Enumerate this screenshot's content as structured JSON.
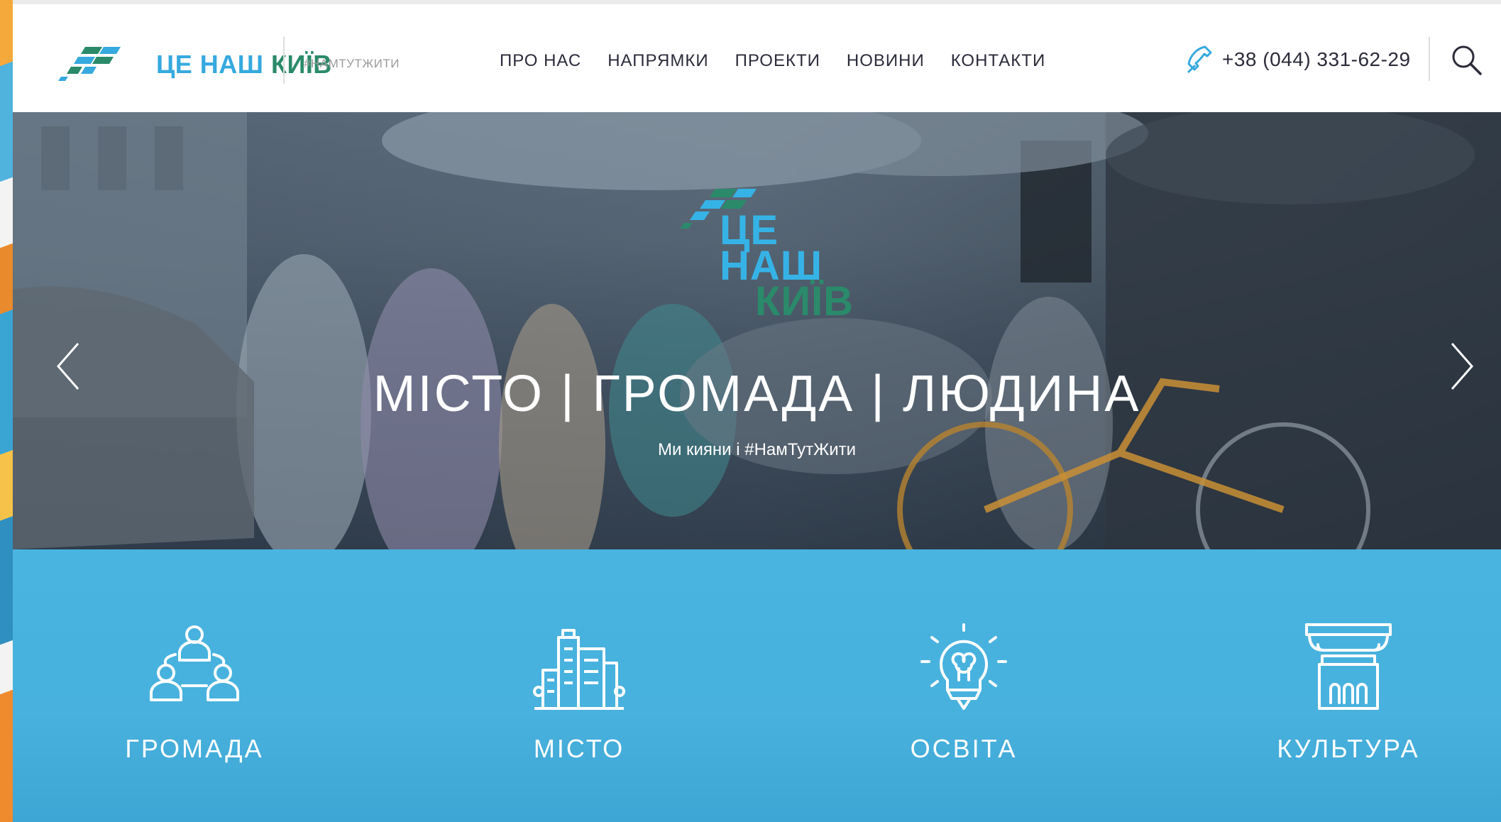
{
  "header": {
    "logo": {
      "part1": "ЦЕ НАШ",
      "part2": "КИЇВ"
    },
    "hashtag": "#НАМТУТЖИТИ",
    "nav": [
      {
        "label": "ПРО НАС"
      },
      {
        "label": "НАПРЯМКИ"
      },
      {
        "label": "ПРОЕКТИ"
      },
      {
        "label": "НОВИНИ"
      },
      {
        "label": "КОНТАКТИ"
      }
    ],
    "phone": "+38 (044) 331-62-29"
  },
  "hero": {
    "logo": {
      "line1": "ЦЕ НАШ",
      "line2": "КИЇВ"
    },
    "title": "МІСТО | ГРОМАДА | ЛЮДИНА",
    "subtitle": "Ми кияни і #НамТутЖити"
  },
  "categories": [
    {
      "label": "ГРОМАДА",
      "icon": "community-icon"
    },
    {
      "label": "МІСТО",
      "icon": "city-icon"
    },
    {
      "label": "ОСВІТА",
      "icon": "lightbulb-icon"
    },
    {
      "label": "КУЛЬТУРА",
      "icon": "column-icon"
    }
  ],
  "colors": {
    "accent_blue": "#36a9df",
    "accent_green": "#2a8a6a",
    "category_band": "#49b4e0"
  }
}
